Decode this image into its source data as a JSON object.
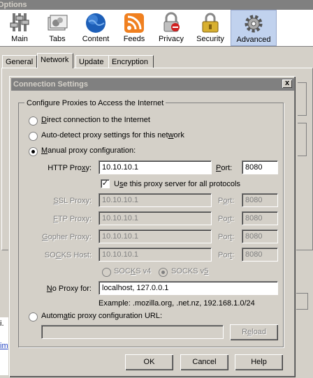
{
  "options_window": {
    "title": "Options",
    "toolbar": [
      {
        "label": "Main",
        "icon": "switch-icon"
      },
      {
        "label": "Tabs",
        "icon": "tabs-icon"
      },
      {
        "label": "Content",
        "icon": "globe-icon"
      },
      {
        "label": "Feeds",
        "icon": "rss-icon"
      },
      {
        "label": "Privacy",
        "icon": "lock-icon"
      },
      {
        "label": "Security",
        "icon": "padlock-icon"
      },
      {
        "label": "Advanced",
        "icon": "gear-icon",
        "selected": true
      }
    ],
    "tabs": [
      {
        "label": "General"
      },
      {
        "label": "Network",
        "active": true
      },
      {
        "label": "Update"
      },
      {
        "label": "Encryption"
      }
    ],
    "strip_text1": "i.",
    "strip_text2": "im"
  },
  "dialog": {
    "title": "Connection Settings",
    "close_label": "x",
    "group_title": "Configure Proxies to Access the Internet",
    "direct": {
      "label_pre": "",
      "label_u": "D",
      "label_post": "irect connection to the Internet"
    },
    "autodetect": {
      "label_pre": "Auto-detect proxy settings for this net",
      "label_u": "w",
      "label_post": "ork"
    },
    "manual": {
      "label_pre": "",
      "label_u": "M",
      "label_post": "anual proxy configuration:"
    },
    "http": {
      "label_pre": "HTTP Pro",
      "label_u": "x",
      "label_post": "y:",
      "value": "10.10.10.1",
      "port_label_pre": "",
      "port_label_u": "P",
      "port_label_post": "ort:",
      "port": "8080"
    },
    "use_for_all": {
      "label_pre": "U",
      "label_u": "s",
      "label_post": "e this proxy server for all protocols",
      "checked_mark": "✓"
    },
    "ssl": {
      "label_pre": "",
      "label_u": "S",
      "label_post": "SL Proxy:",
      "value": "10.10.10.1",
      "port_label_pre": "P",
      "port_label_u": "o",
      "port_label_post": "rt:",
      "port": "8080"
    },
    "ftp": {
      "label_pre": "",
      "label_u": "F",
      "label_post": "TP Proxy:",
      "value": "10.10.10.1",
      "port_label_pre": "Po",
      "port_label_u": "r",
      "port_label_post": "t:",
      "port": "8080"
    },
    "gopher": {
      "label_pre": "",
      "label_u": "G",
      "label_post": "opher Proxy:",
      "value": "10.10.10.1",
      "port_label_pre": "Por",
      "port_label_u": "t",
      "port_label_post": ":",
      "port": "8080"
    },
    "socks": {
      "label_pre": "SO",
      "label_u": "C",
      "label_post": "KS Host:",
      "value": "10.10.10.1",
      "port_label_pre": "Por",
      "port_label_u": "t",
      "port_label_post": ":",
      "port": "8080"
    },
    "socks_v4": {
      "label_pre": "SOC",
      "label_u": "K",
      "label_post": "S v4"
    },
    "socks_v5": {
      "label_pre": "SOCKS v",
      "label_u": "5",
      "label_post": ""
    },
    "no_proxy": {
      "label_pre": "",
      "label_u": "N",
      "label_post": "o Proxy for:",
      "value": "localhost, 127.0.0.1"
    },
    "example": "Example: .mozilla.org, .net.nz, 192.168.1.0/24",
    "auto_url": {
      "label_pre": "Autom",
      "label_u": "a",
      "label_post": "tic proxy configuration URL:",
      "value": ""
    },
    "reload_label_pre": "R",
    "reload_label_u": "e",
    "reload_label_post": "load",
    "ok_label": "OK",
    "cancel_label": "Cancel",
    "help_label": "Help"
  }
}
